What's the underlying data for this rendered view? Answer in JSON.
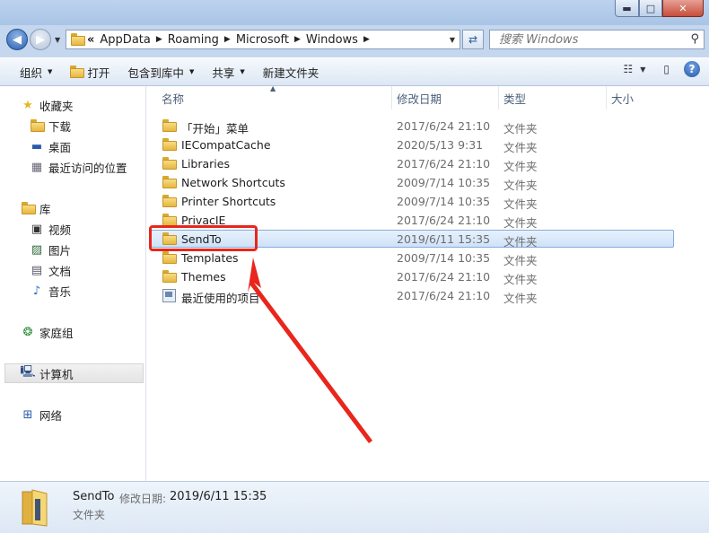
{
  "window": {
    "caption_buttons": {
      "minimize": "▬",
      "maximize": "□",
      "close": "✕"
    }
  },
  "nav": {
    "breadcrumbs": [
      "AppData",
      "Roaming",
      "Microsoft",
      "Windows"
    ],
    "overflow": "«",
    "search_placeholder": "搜索 Windows"
  },
  "toolbar": {
    "organize": "组织",
    "open": "打开",
    "include_in_library": "包含到库中",
    "share": "共享",
    "new_folder": "新建文件夹"
  },
  "sidebar": {
    "favorites": "收藏夹",
    "downloads": "下载",
    "desktop": "桌面",
    "recent": "最近访问的位置",
    "libraries": "库",
    "videos": "视频",
    "pictures": "图片",
    "documents": "文档",
    "music": "音乐",
    "homegroup": "家庭组",
    "computer": "计算机",
    "network": "网络"
  },
  "columns": {
    "name": "名称",
    "date": "修改日期",
    "type": "类型",
    "size": "大小"
  },
  "files": [
    {
      "name": "「开始」菜单",
      "date": "2017/6/24 21:10",
      "type": "文件夹",
      "icon": "folder-icon"
    },
    {
      "name": "IECompatCache",
      "date": "2020/5/13 9:31",
      "type": "文件夹",
      "icon": "folder-icon"
    },
    {
      "name": "Libraries",
      "date": "2017/6/24 21:10",
      "type": "文件夹",
      "icon": "folder-icon"
    },
    {
      "name": "Network Shortcuts",
      "date": "2009/7/14 10:35",
      "type": "文件夹",
      "icon": "folder-icon"
    },
    {
      "name": "Printer Shortcuts",
      "date": "2009/7/14 10:35",
      "type": "文件夹",
      "icon": "folder-icon"
    },
    {
      "name": "PrivacIE",
      "date": "2017/6/24 21:10",
      "type": "文件夹",
      "icon": "folder-icon"
    },
    {
      "name": "SendTo",
      "date": "2019/6/11 15:35",
      "type": "文件夹",
      "icon": "folder-icon",
      "selected": true
    },
    {
      "name": "Templates",
      "date": "2009/7/14 10:35",
      "type": "文件夹",
      "icon": "folder-icon"
    },
    {
      "name": "Themes",
      "date": "2017/6/24 21:10",
      "type": "文件夹",
      "icon": "folder-icon"
    },
    {
      "name": "最近使用的项目",
      "date": "2017/6/24 21:10",
      "type": "文件夹",
      "icon": "shortcut-folder-icon"
    }
  ],
  "details": {
    "name": "SendTo",
    "date_label": "修改日期:",
    "date_value": "2019/6/11 15:35",
    "type": "文件夹"
  },
  "annotation": {
    "color": "#e8261c"
  }
}
